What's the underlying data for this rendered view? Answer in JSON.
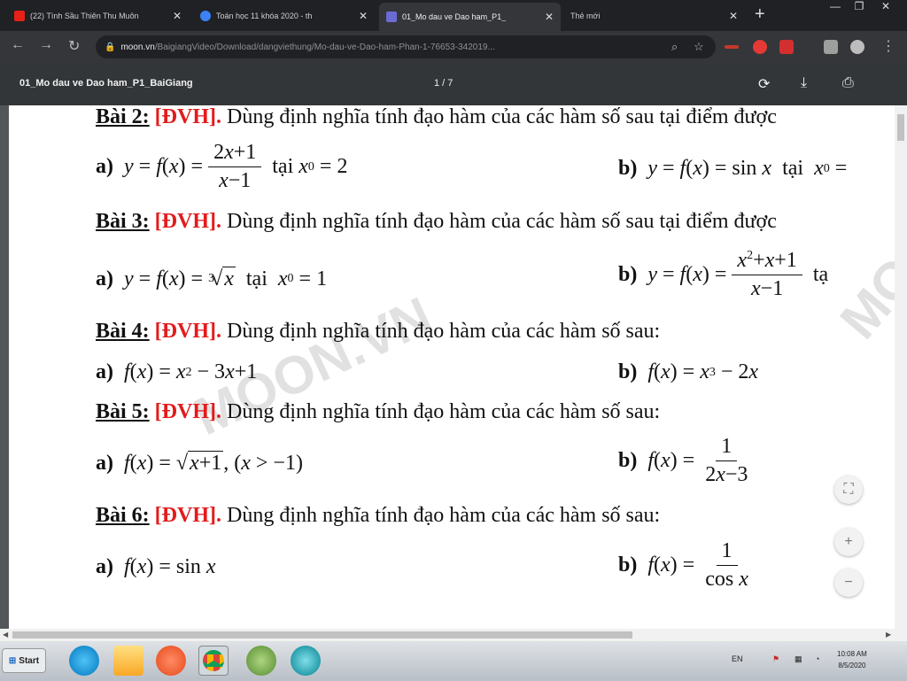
{
  "browser": {
    "tabs": [
      {
        "title": "(22) Tình Sầu Thiên Thu Muôn",
        "favicon_color": "#e62117"
      },
      {
        "title": "Toán học 11 khóa 2020 - th",
        "favicon_color": "#3b82f6"
      },
      {
        "title": "01_Mo dau ve Dao ham_P1_",
        "favicon_color": "#6b6bd6"
      },
      {
        "title": "Thẻ mới",
        "favicon_color": ""
      }
    ],
    "url_host": "moon.vn",
    "url_path": "/BaigiangVideo/Download/dangviethung/Mo-dau-ve-Dao-ham-Phan-1-76653-342019..."
  },
  "pdf": {
    "title": "01_Mo dau ve Dao ham_P1_BaiGiang",
    "page_indicator": "1 / 7"
  },
  "doc": {
    "tag": "[ĐVH].",
    "watermark": "MOON.VN",
    "problems": [
      {
        "label": "Bài 2:",
        "text": "Dùng định nghĩa tính đạo hàm của các hàm số sau tại điểm được"
      },
      {
        "label": "Bài 3:",
        "text": "Dùng định nghĩa tính đạo hàm của các hàm số sau tại điểm được"
      },
      {
        "label": "Bài 4:",
        "text": "Dùng định nghĩa tính đạo hàm của các hàm số sau:"
      },
      {
        "label": "Bài 5:",
        "text": "Dùng định nghĩa tính đạo hàm của các hàm số sau:"
      },
      {
        "label": "Bài 6:",
        "text": "Dùng định nghĩa tính đạo hàm của các hàm số sau:"
      }
    ],
    "words": {
      "a": "a)",
      "b": "b)",
      "tai": "tại",
      "ta": "tạ"
    }
  },
  "taskbar": {
    "start_label": "Start",
    "lang": "EN",
    "time": "10:08 AM",
    "date": "8/5/2020"
  }
}
